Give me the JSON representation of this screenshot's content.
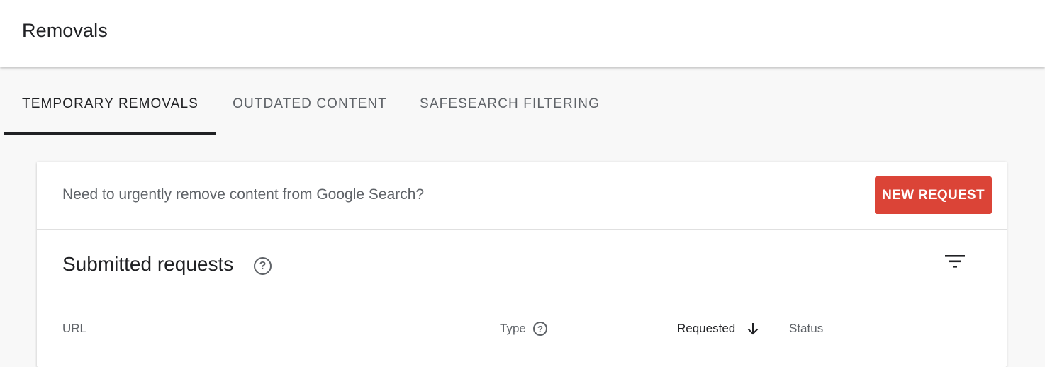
{
  "header": {
    "title": "Removals"
  },
  "tabs": [
    {
      "label": "TEMPORARY REMOVALS",
      "active": true
    },
    {
      "label": "OUTDATED CONTENT",
      "active": false
    },
    {
      "label": "SAFESEARCH FILTERING",
      "active": false
    }
  ],
  "banner": {
    "text": "Need to urgently remove content from Google Search?",
    "button_label": "NEW REQUEST",
    "button_color": "#db4437"
  },
  "requests": {
    "title": "Submitted requests",
    "help_icon": "help-circle-icon",
    "filter_icon": "filter-icon",
    "columns": [
      {
        "label": "URL"
      },
      {
        "label": "Type",
        "help_icon": "help-circle-icon"
      },
      {
        "label": "Requested",
        "sort": "descending",
        "sort_icon": "arrow-down-icon"
      },
      {
        "label": "Status"
      }
    ]
  }
}
